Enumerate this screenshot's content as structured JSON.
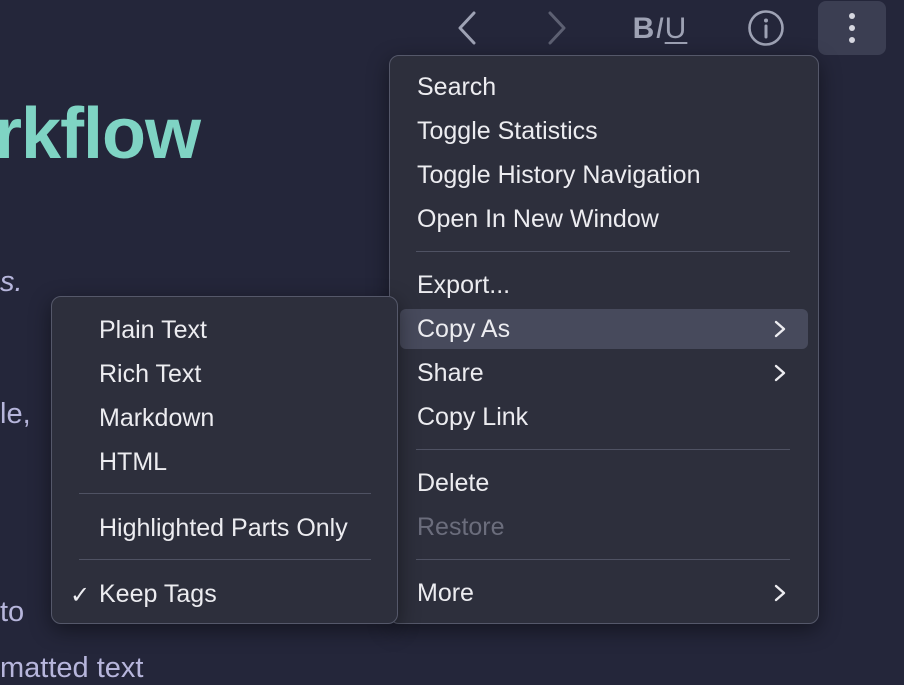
{
  "toolbar": {
    "format": {
      "bold": "B",
      "italic": "I",
      "underline": "U"
    },
    "icons": [
      "chevron-left-icon",
      "chevron-right-icon",
      "info-icon",
      "more-vertical-icon"
    ]
  },
  "document": {
    "heading": "rkflow",
    "lines": [
      "s.",
      "le,",
      "to",
      "matted text"
    ]
  },
  "main_menu": {
    "items": [
      {
        "label": "Search"
      },
      {
        "label": "Toggle Statistics"
      },
      {
        "label": "Toggle History Navigation"
      },
      {
        "label": "Open In New Window"
      },
      {
        "label": "Export..."
      },
      {
        "label": "Copy As",
        "state": "highlighted",
        "submenu": true
      },
      {
        "label": "Share",
        "submenu": true
      },
      {
        "label": "Copy Link"
      },
      {
        "label": "Delete"
      },
      {
        "label": "Restore",
        "state": "disabled"
      },
      {
        "label": "More",
        "submenu": true
      }
    ]
  },
  "copy_as_menu": {
    "items": [
      {
        "label": "Plain Text"
      },
      {
        "label": "Rich Text"
      },
      {
        "label": "Markdown"
      },
      {
        "label": "HTML"
      },
      {
        "label": "Highlighted Parts Only"
      },
      {
        "label": "Keep Tags",
        "checked": true
      }
    ],
    "check_mark": "✓"
  },
  "colors": {
    "background": "#24263a",
    "menu": "#2d2f3c",
    "highlight": "#474a5c",
    "heading": "#7fd4c4",
    "body_text": "#b7b6dc"
  }
}
